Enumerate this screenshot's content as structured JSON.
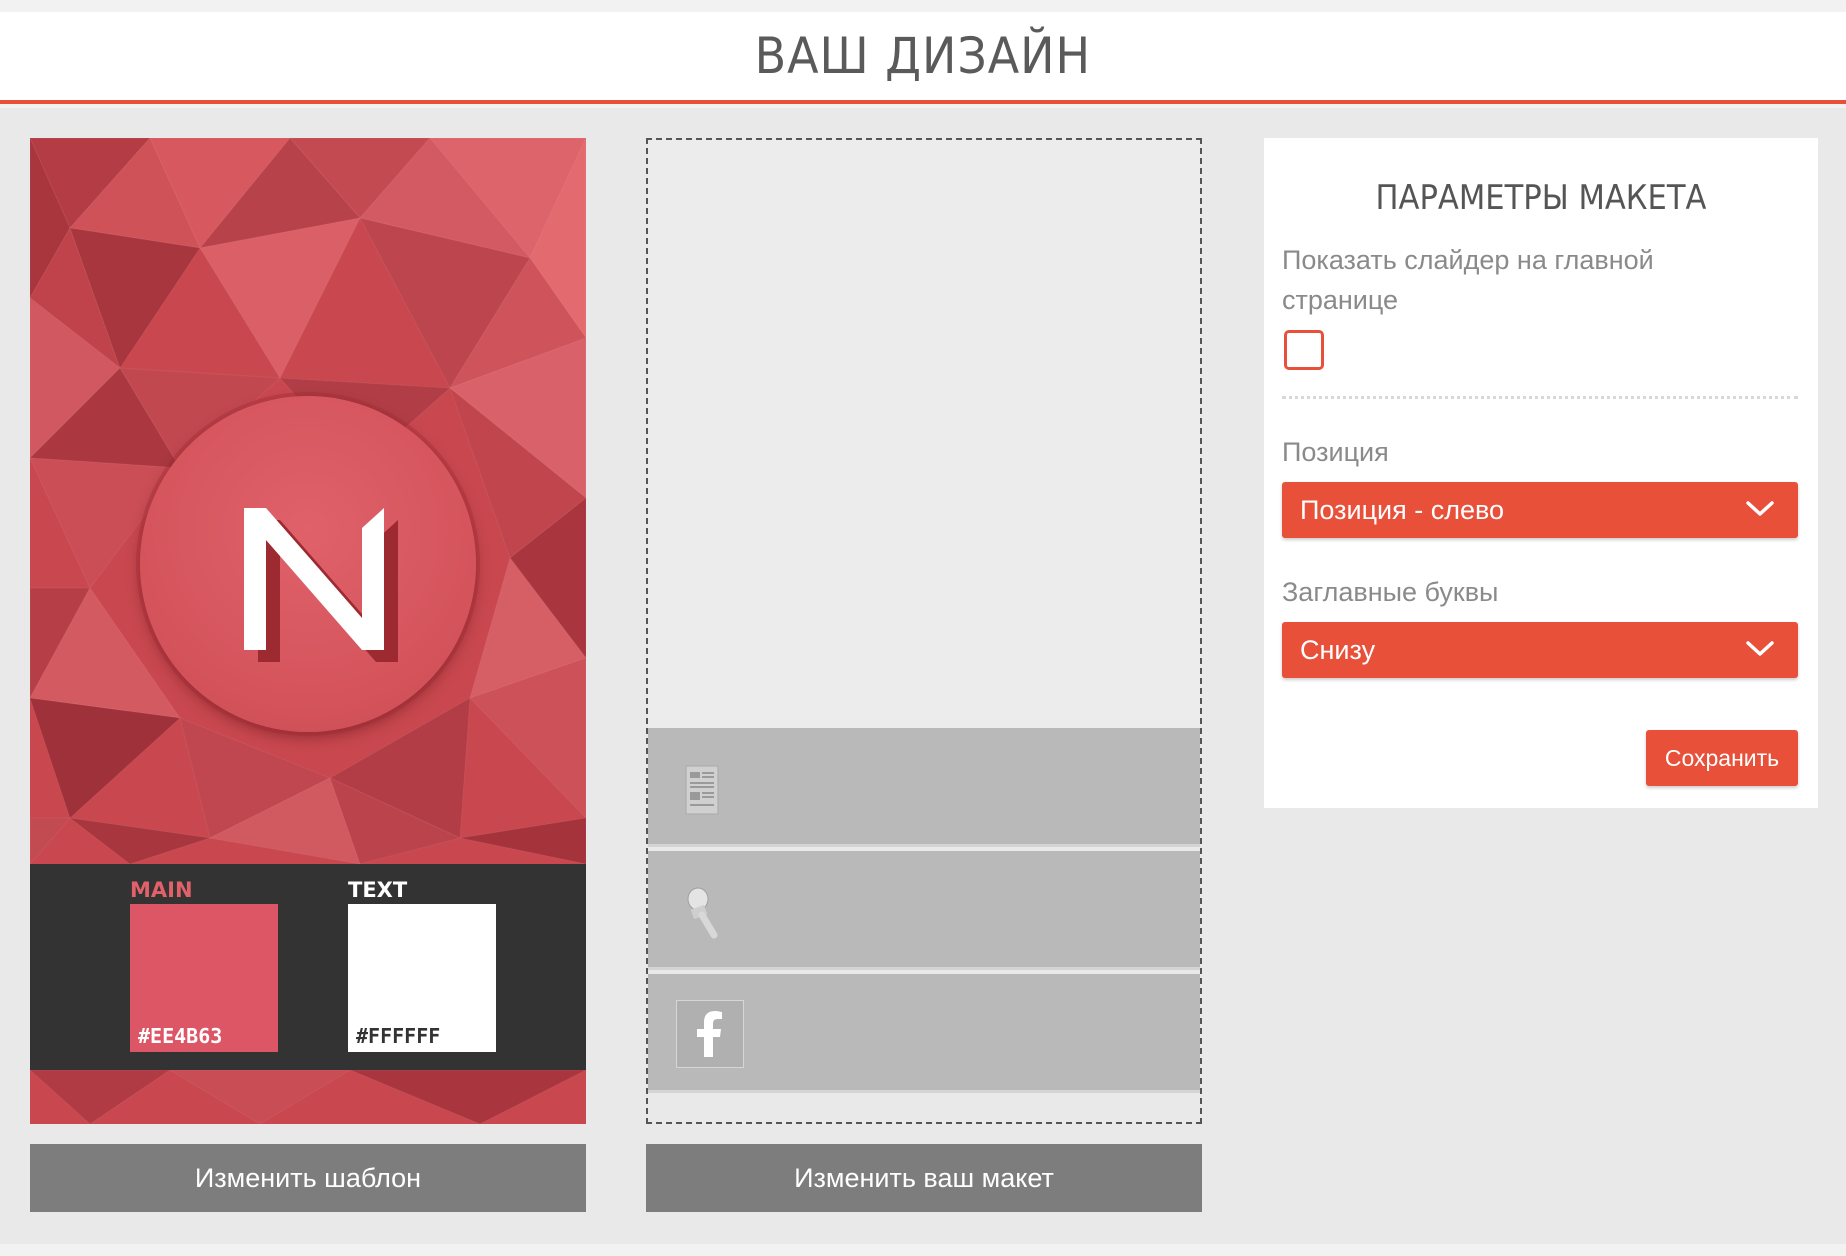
{
  "header": {
    "title": "ВАШ ДИЗАЙН"
  },
  "template": {
    "swatches": [
      {
        "label": "MAIN",
        "label_color": "#e0616a",
        "code": "#EE4B63",
        "color": "#dc5665",
        "code_color": "#ffffff"
      },
      {
        "label": "TEXT",
        "label_color": "#ffffff",
        "code": "#FFFFFF",
        "color": "#ffffff",
        "code_color": "#333333"
      }
    ],
    "change_button": "Изменить шаблон"
  },
  "layout": {
    "rows": [
      {
        "icon": "news-icon"
      },
      {
        "icon": "microphone-icon"
      },
      {
        "icon": "facebook-icon"
      }
    ],
    "change_button": "Изменить ваш макет"
  },
  "params": {
    "title": "ПАРАМЕТРЫ МАКЕТА",
    "slider_label_line1": "Показать слайдер на главной",
    "slider_label_line2": "странице",
    "slider_checked": false,
    "position_label": "Позиция",
    "position_value": "Позиция - слево",
    "capitals_label": "Заглавные буквы",
    "capitals_value": "Снизу",
    "save_label": "Сохранить"
  },
  "colors": {
    "accent": "#e8503a",
    "template_bg": "#c9484f",
    "swatch_panel": "#333333",
    "button_gray": "#7d7d7d"
  }
}
